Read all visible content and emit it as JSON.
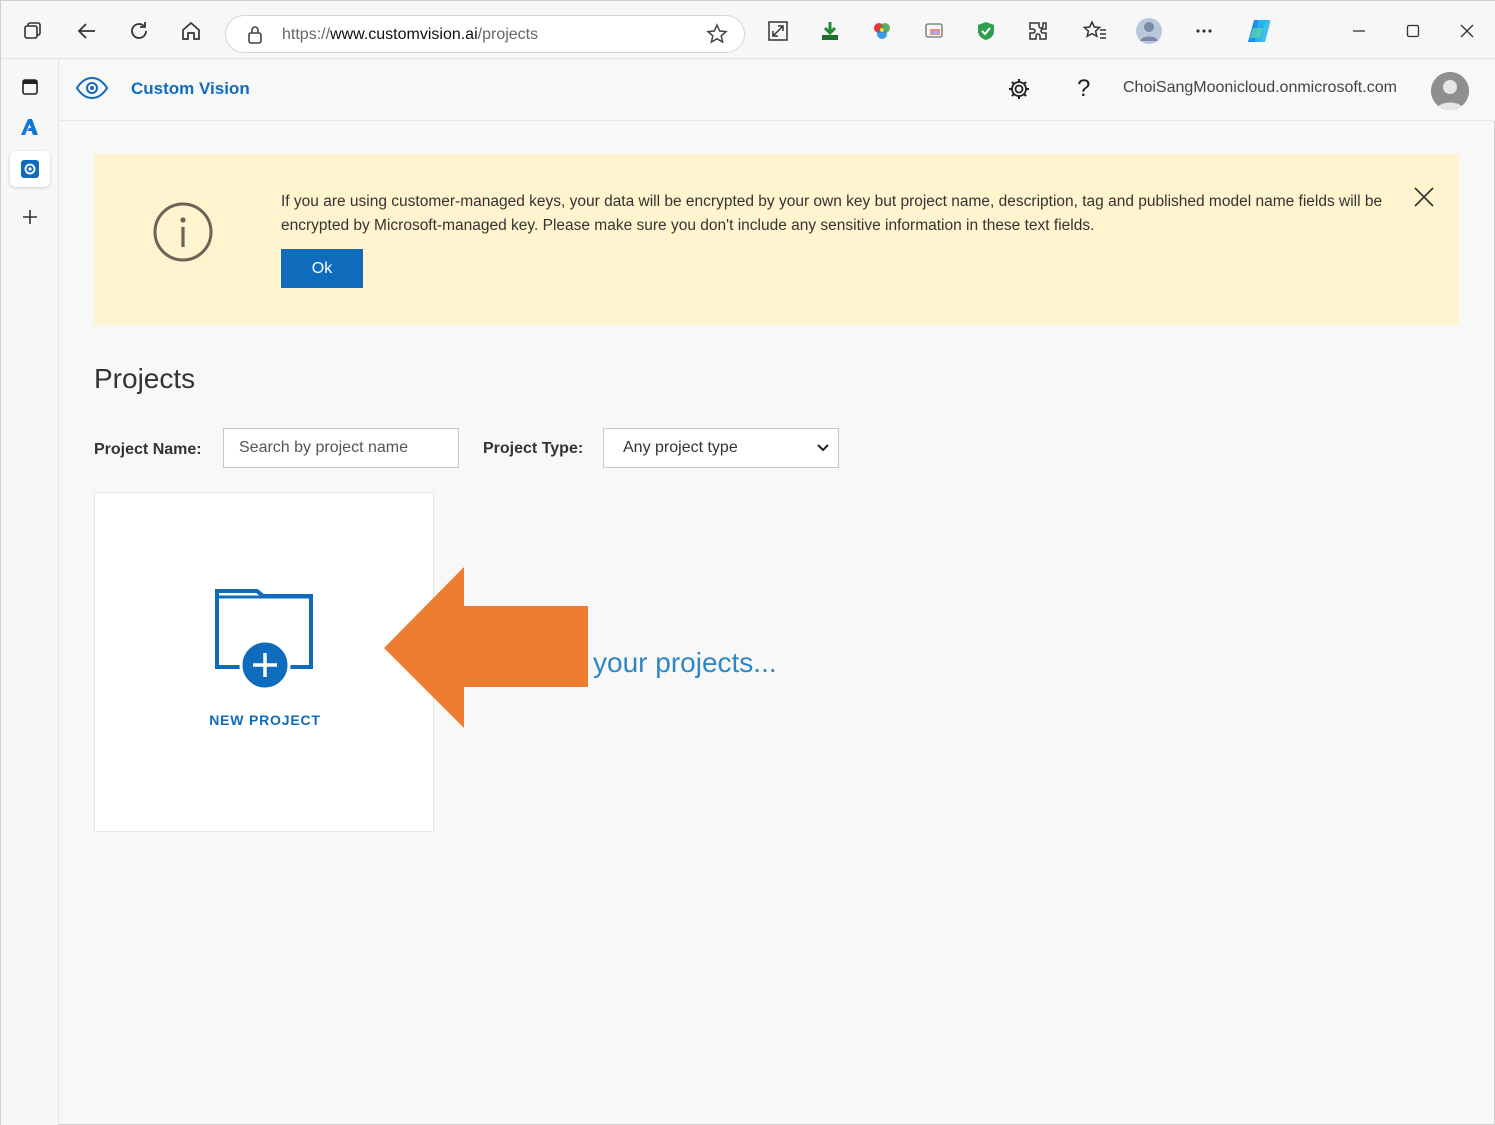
{
  "browser": {
    "url_prefix": "https://",
    "url_host": "www.customvision.ai",
    "url_path": "/projects"
  },
  "app": {
    "name": "Custom Vision",
    "user_email": "ChoiSangMoonicloud.onmicrosoft.com",
    "help_symbol": "?"
  },
  "banner": {
    "message": "If you are using customer-managed keys, your data will be encrypted by your own key but project name, description, tag and published model name fields will be encrypted by Microsoft-managed key. Please make sure you don't include any sensitive information in these text fields.",
    "ok_label": "Ok"
  },
  "projects": {
    "title": "Projects",
    "name_label": "Project Name:",
    "search_placeholder": "Search by project name",
    "type_label": "Project Type:",
    "type_selected": "Any project type",
    "new_project_label": "NEW PROJECT",
    "loading_text": "your projects..."
  },
  "colors": {
    "accent": "#0f6cbd",
    "banner_bg": "#fff4ce",
    "annotation_arrow": "#ed7d31"
  }
}
